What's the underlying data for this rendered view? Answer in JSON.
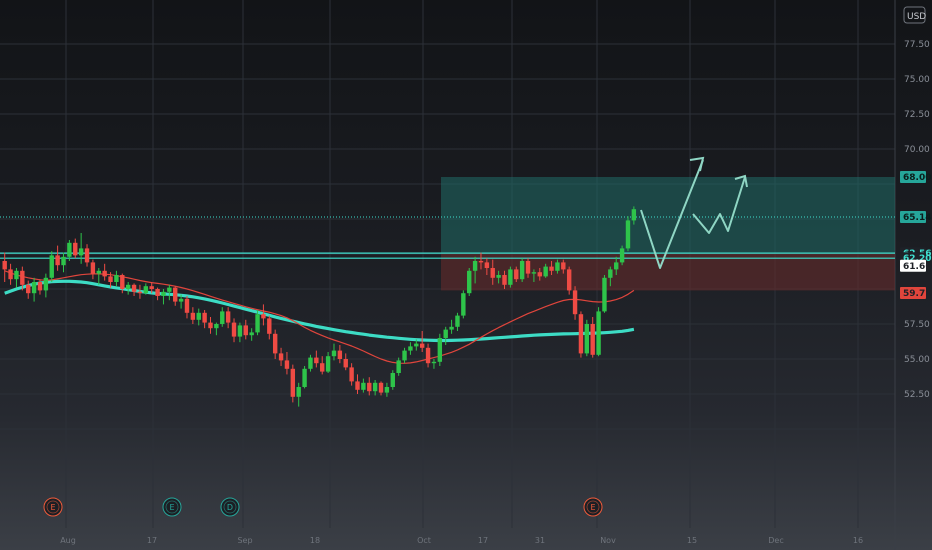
{
  "chart_data": {
    "type": "candlestick",
    "currency": "USD",
    "y_ticks": [
      "77.50",
      "75.00",
      "72.50",
      "70.00",
      "57.50",
      "55.00",
      "52.50"
    ],
    "ylim": [
      50.3,
      79.2
    ],
    "x_ticks": [
      "Aug",
      "17",
      "Sep",
      "18",
      "Oct",
      "17",
      "31",
      "Nov",
      "15",
      "Dec",
      "16"
    ],
    "grid": true,
    "candles": [
      [
        62.0,
        62.6,
        60.5,
        61.4
      ],
      [
        61.4,
        61.8,
        60.3,
        60.7
      ],
      [
        60.7,
        61.5,
        60.1,
        61.3
      ],
      [
        61.3,
        61.6,
        59.9,
        60.3
      ],
      [
        60.3,
        60.6,
        59.3,
        59.7
      ],
      [
        59.7,
        60.8,
        59.1,
        60.5
      ],
      [
        60.5,
        60.7,
        59.6,
        59.9
      ],
      [
        59.9,
        61.1,
        59.4,
        60.8
      ],
      [
        60.8,
        62.7,
        60.5,
        62.4
      ],
      [
        62.4,
        63.1,
        61.3,
        61.7
      ],
      [
        61.7,
        62.6,
        61.2,
        62.3
      ],
      [
        62.3,
        63.5,
        62.0,
        63.3
      ],
      [
        63.3,
        63.6,
        62.2,
        62.4
      ],
      [
        62.4,
        64.0,
        61.8,
        62.9
      ],
      [
        62.9,
        63.2,
        61.6,
        61.9
      ],
      [
        61.9,
        62.1,
        60.7,
        61.1
      ],
      [
        61.1,
        61.5,
        60.3,
        61.3
      ],
      [
        61.3,
        61.8,
        60.6,
        60.9
      ],
      [
        60.9,
        61.2,
        60.1,
        60.5
      ],
      [
        60.5,
        61.3,
        60.2,
        61.0
      ],
      [
        61.0,
        61.1,
        59.7,
        60.0
      ],
      [
        60.0,
        60.5,
        59.6,
        60.3
      ],
      [
        60.3,
        60.4,
        59.5,
        59.8
      ],
      [
        59.8,
        60.3,
        59.3,
        59.7
      ],
      [
        59.7,
        60.4,
        59.6,
        60.2
      ],
      [
        60.2,
        60.5,
        59.7,
        60.0
      ],
      [
        60.0,
        60.1,
        59.2,
        59.5
      ],
      [
        59.5,
        60.0,
        58.9,
        59.8
      ],
      [
        59.8,
        60.3,
        59.2,
        60.1
      ],
      [
        60.1,
        60.2,
        58.8,
        59.1
      ],
      [
        59.1,
        59.6,
        58.6,
        59.3
      ],
      [
        59.3,
        59.5,
        57.9,
        58.3
      ],
      [
        58.3,
        58.7,
        57.5,
        57.8
      ],
      [
        57.8,
        58.6,
        57.4,
        58.3
      ],
      [
        58.3,
        58.5,
        57.2,
        57.6
      ],
      [
        57.6,
        58.0,
        56.8,
        57.2
      ],
      [
        57.2,
        57.6,
        56.7,
        57.5
      ],
      [
        57.5,
        58.7,
        57.3,
        58.4
      ],
      [
        58.4,
        58.7,
        57.2,
        57.6
      ],
      [
        57.6,
        57.9,
        56.2,
        56.6
      ],
      [
        56.6,
        57.6,
        56.2,
        57.4
      ],
      [
        57.4,
        57.8,
        56.4,
        56.7
      ],
      [
        56.7,
        57.2,
        56.3,
        56.9
      ],
      [
        56.9,
        58.5,
        56.7,
        58.2
      ],
      [
        58.2,
        58.9,
        57.4,
        57.9
      ],
      [
        57.9,
        58.1,
        56.4,
        56.8
      ],
      [
        56.8,
        57.1,
        55.0,
        55.4
      ],
      [
        55.4,
        55.8,
        54.5,
        54.9
      ],
      [
        54.9,
        55.5,
        53.9,
        54.3
      ],
      [
        54.3,
        54.6,
        51.9,
        52.3
      ],
      [
        52.3,
        53.3,
        51.6,
        53.0
      ],
      [
        53.0,
        54.5,
        52.9,
        54.3
      ],
      [
        54.3,
        55.3,
        54.1,
        55.1
      ],
      [
        55.1,
        55.6,
        54.4,
        54.7
      ],
      [
        54.7,
        55.2,
        53.9,
        54.1
      ],
      [
        54.1,
        55.5,
        54.0,
        55.2
      ],
      [
        55.2,
        56.1,
        54.9,
        55.6
      ],
      [
        55.6,
        56.0,
        54.7,
        55.0
      ],
      [
        55.0,
        55.4,
        54.2,
        54.4
      ],
      [
        54.4,
        54.7,
        53.1,
        53.4
      ],
      [
        53.4,
        53.9,
        52.5,
        52.8
      ],
      [
        52.8,
        53.6,
        52.6,
        53.3
      ],
      [
        53.3,
        53.7,
        52.4,
        52.7
      ],
      [
        52.7,
        53.5,
        52.4,
        53.3
      ],
      [
        53.3,
        53.4,
        52.4,
        52.6
      ],
      [
        52.6,
        53.3,
        52.3,
        53.0
      ],
      [
        53.0,
        54.2,
        52.8,
        54.0
      ],
      [
        54.0,
        55.1,
        53.8,
        54.9
      ],
      [
        54.9,
        55.8,
        54.7,
        55.6
      ],
      [
        55.6,
        56.2,
        55.3,
        55.9
      ],
      [
        55.9,
        56.4,
        55.6,
        56.1
      ],
      [
        56.1,
        57.0,
        55.5,
        55.8
      ],
      [
        55.8,
        56.1,
        54.4,
        54.7
      ],
      [
        54.7,
        55.0,
        54.3,
        54.8
      ],
      [
        54.8,
        56.8,
        54.5,
        56.5
      ],
      [
        56.5,
        57.3,
        56.0,
        57.1
      ],
      [
        57.1,
        57.8,
        56.8,
        57.3
      ],
      [
        57.3,
        58.3,
        57.0,
        58.1
      ],
      [
        58.1,
        59.9,
        57.9,
        59.7
      ],
      [
        59.7,
        61.5,
        59.5,
        61.3
      ],
      [
        61.3,
        62.3,
        60.4,
        62.0
      ],
      [
        62.0,
        62.6,
        61.4,
        61.9
      ],
      [
        61.9,
        62.2,
        61.0,
        61.5
      ],
      [
        61.5,
        62.1,
        60.3,
        60.8
      ],
      [
        60.8,
        61.3,
        60.4,
        61.0
      ],
      [
        61.0,
        61.3,
        60.0,
        60.3
      ],
      [
        60.3,
        61.6,
        60.1,
        61.4
      ],
      [
        61.4,
        61.6,
        60.5,
        60.7
      ],
      [
        60.7,
        62.2,
        60.5,
        62.0
      ],
      [
        62.0,
        62.2,
        60.8,
        61.1
      ],
      [
        61.1,
        61.4,
        60.5,
        61.2
      ],
      [
        61.2,
        61.5,
        60.6,
        60.9
      ],
      [
        60.9,
        61.8,
        60.8,
        61.6
      ],
      [
        61.6,
        62.0,
        61.0,
        61.3
      ],
      [
        61.3,
        62.1,
        61.1,
        61.9
      ],
      [
        61.9,
        62.1,
        61.1,
        61.4
      ],
      [
        61.4,
        61.6,
        59.6,
        59.9
      ],
      [
        59.9,
        60.2,
        57.8,
        58.2
      ],
      [
        58.2,
        58.4,
        55.1,
        55.4
      ],
      [
        55.4,
        57.8,
        55.2,
        57.5
      ],
      [
        57.5,
        58.0,
        55.1,
        55.3
      ],
      [
        55.3,
        58.7,
        55.2,
        58.4
      ],
      [
        58.4,
        61.0,
        58.3,
        60.8
      ],
      [
        60.8,
        61.6,
        60.2,
        61.4
      ],
      [
        61.4,
        62.3,
        61.0,
        61.9
      ],
      [
        61.9,
        63.1,
        61.7,
        62.9
      ],
      [
        62.9,
        65.2,
        62.7,
        64.9
      ],
      [
        64.9,
        65.9,
        64.6,
        65.7
      ]
    ],
    "ma_slow": [
      59.7,
      59.85,
      60.0,
      60.12,
      60.24,
      60.34,
      60.42,
      60.48,
      60.52,
      60.54,
      60.55,
      60.55,
      60.53,
      60.5,
      60.45,
      60.38,
      60.3,
      60.22,
      60.15,
      60.08,
      60.02,
      59.95,
      59.89,
      59.83,
      59.77,
      59.72,
      59.68,
      59.65,
      59.62,
      59.59,
      59.55,
      59.5,
      59.44,
      59.37,
      59.29,
      59.2,
      59.1,
      59.0,
      58.89,
      58.78,
      58.67,
      58.56,
      58.45,
      58.34,
      58.23,
      58.12,
      58.01,
      57.9,
      57.8,
      57.7,
      57.6,
      57.51,
      57.42,
      57.33,
      57.25,
      57.17,
      57.09,
      57.02,
      56.95,
      56.89,
      56.83,
      56.77,
      56.71,
      56.66,
      56.61,
      56.56,
      56.52,
      56.48,
      56.44,
      56.41,
      56.38,
      56.36,
      56.34,
      56.33,
      56.32,
      56.32,
      56.33,
      56.34,
      56.36,
      56.38,
      56.4,
      56.43,
      56.46,
      56.49,
      56.52,
      56.55,
      56.58,
      56.61,
      56.64,
      56.67,
      56.7,
      56.72,
      56.74,
      56.76,
      56.78,
      56.79,
      56.8,
      56.81,
      56.82,
      56.83,
      56.84,
      56.86,
      56.88,
      56.91,
      56.94,
      56.98,
      57.04,
      57.12
    ],
    "ma_fast": [
      61.3,
      61.15,
      61.0,
      60.9,
      60.8,
      60.72,
      60.66,
      60.62,
      60.65,
      60.72,
      60.8,
      60.88,
      60.96,
      61.02,
      61.06,
      61.08,
      61.08,
      61.06,
      61.02,
      60.96,
      60.88,
      60.79,
      60.7,
      60.61,
      60.53,
      60.46,
      60.4,
      60.34,
      60.28,
      60.2,
      60.11,
      60.0,
      59.88,
      59.75,
      59.62,
      59.48,
      59.34,
      59.21,
      59.09,
      58.97,
      58.85,
      58.73,
      58.62,
      58.52,
      58.43,
      58.34,
      58.23,
      58.1,
      57.94,
      57.74,
      57.5,
      57.26,
      57.04,
      56.85,
      56.67,
      56.51,
      56.36,
      56.22,
      56.08,
      55.93,
      55.76,
      55.57,
      55.37,
      55.18,
      55.0,
      54.86,
      54.76,
      54.7,
      54.69,
      54.72,
      54.79,
      54.89,
      55.0,
      55.1,
      55.21,
      55.34,
      55.48,
      55.65,
      55.84,
      56.05,
      56.3,
      56.55,
      56.79,
      57.02,
      57.24,
      57.45,
      57.66,
      57.86,
      58.05,
      58.24,
      58.41,
      58.58,
      58.74,
      58.9,
      59.05,
      59.18,
      59.25,
      59.26,
      59.22,
      59.16,
      59.1,
      59.07,
      59.08,
      59.14,
      59.24,
      59.4,
      59.62,
      59.9
    ],
    "levels": [
      {
        "label": "68.00",
        "value": 68.0,
        "style": "box",
        "bg": "#26a69a",
        "fg": "#0b1d1b"
      },
      {
        "label": "65.14",
        "value": 65.14,
        "style": "dotted",
        "bg": "#26a69a",
        "fg": "#0b1d1b"
      },
      {
        "label": "62.56",
        "value": 62.56,
        "style": "solid",
        "bg": "#1e2127",
        "fg": "#3fe0d0"
      },
      {
        "label": "62.20",
        "value": 62.2,
        "style": "solid",
        "bg": "#1e2127",
        "fg": "#3fe0d0"
      },
      {
        "label": "61.66",
        "value": 61.66,
        "style": "tag",
        "bg": "#ffffff",
        "fg": "#1e2127"
      },
      {
        "label": "59.71",
        "value": 59.71,
        "style": "tag",
        "bg": "#e0453c",
        "fg": "#1e2127"
      }
    ],
    "zones": [
      {
        "name": "target-zone",
        "from": 62.56,
        "to": 68.0,
        "color": "#1f6b66"
      },
      {
        "name": "stop-zone",
        "from": 59.9,
        "to": 62.56,
        "color": "#6b2c2c"
      }
    ],
    "event_markers": [
      {
        "letter": "E",
        "color": "#f05b3a"
      },
      {
        "letter": "E",
        "color": "#26a69a"
      },
      {
        "letter": "D",
        "color": "#26a69a"
      },
      {
        "letter": "E",
        "color": "#f05b3a"
      }
    ],
    "colors": {
      "up": "#2ec44a",
      "down": "#ef4b44",
      "ma_slow": "#3ddcc5",
      "ma_fast": "#e0453c",
      "arrow": "#8fd6c4"
    }
  }
}
